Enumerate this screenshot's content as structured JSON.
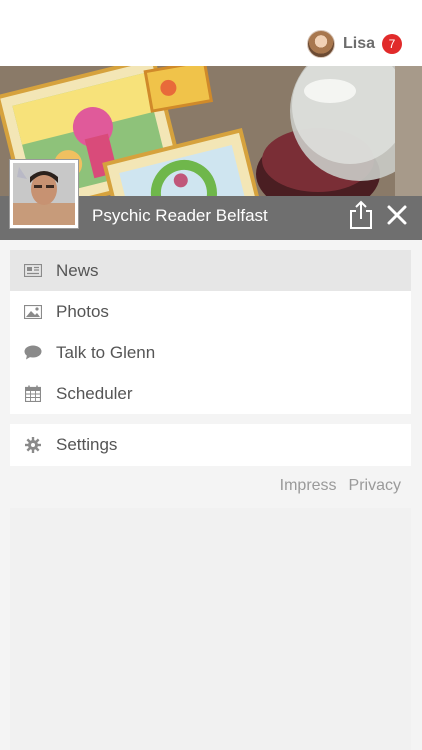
{
  "header": {
    "user_name": "Lisa",
    "notification_count": "7"
  },
  "profile": {
    "name": "Psychic Reader Belfast"
  },
  "menu": {
    "items": [
      {
        "label": "News",
        "icon": "newspaper-icon",
        "active": true
      },
      {
        "label": "Photos",
        "icon": "image-icon",
        "active": false
      },
      {
        "label": "Talk to Glenn",
        "icon": "chat-bubble-icon",
        "active": false
      },
      {
        "label": "Scheduler",
        "icon": "calendar-icon",
        "active": false
      }
    ],
    "settings": {
      "label": "Settings",
      "icon": "gear-icon"
    }
  },
  "footer": {
    "impress": "Impress",
    "privacy": "Privacy"
  },
  "colors": {
    "badge": "#e12a2a",
    "profile_bar": "#6f6f6f",
    "active_item": "#e6e6e6",
    "menu_background": "#f4f4f4"
  }
}
